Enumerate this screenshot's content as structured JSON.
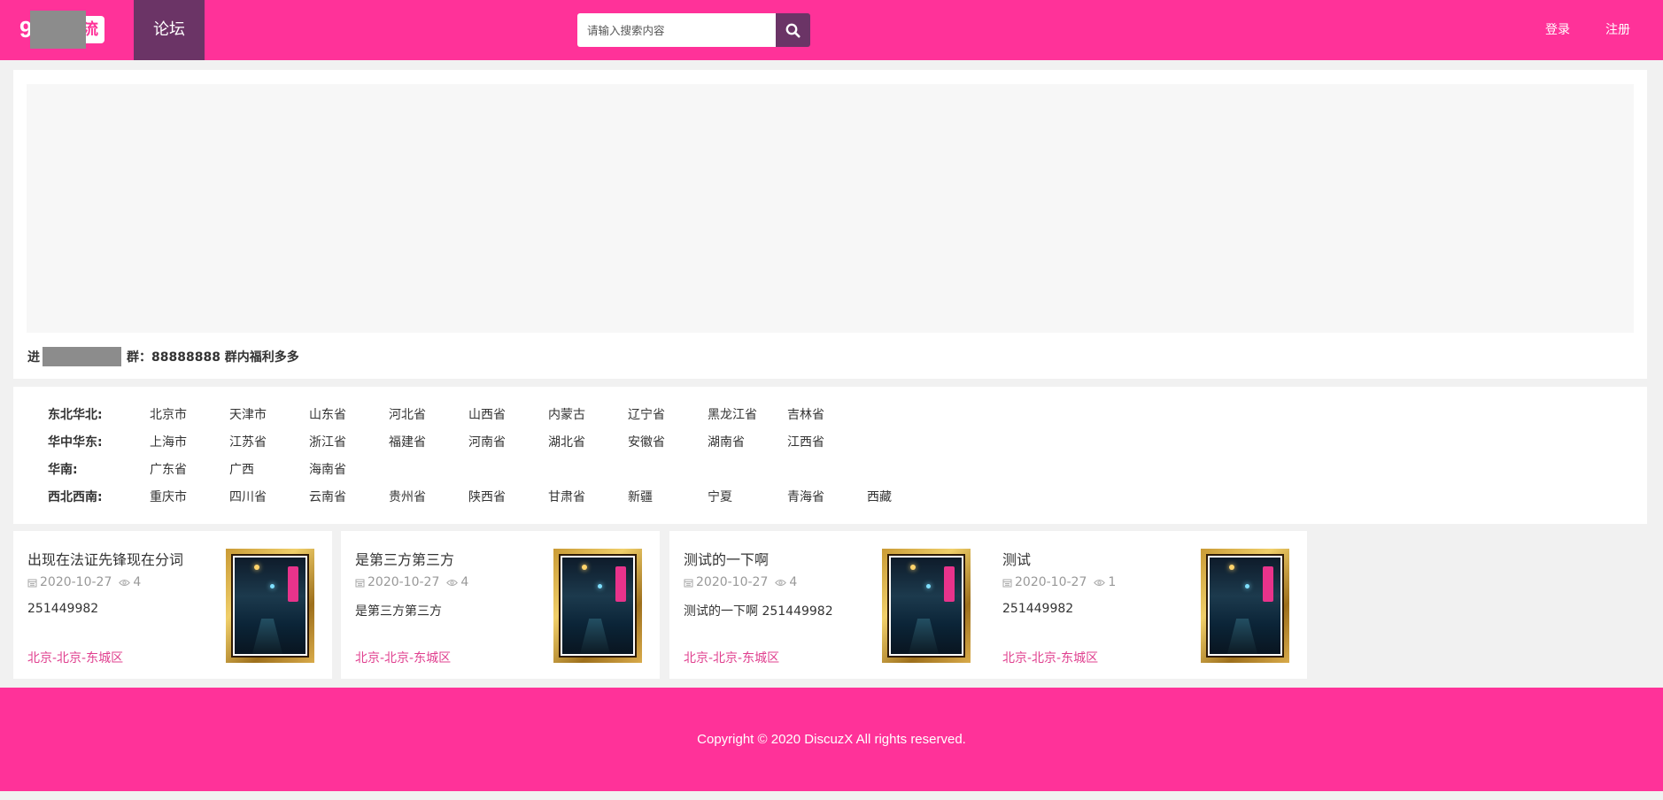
{
  "colors": {
    "brand": "#ff3299",
    "nav_active": "#6b3466",
    "location": "#e0408f"
  },
  "header": {
    "logo": {
      "mark": "9",
      "box_text": "流"
    },
    "nav": [
      {
        "label": "论坛",
        "active": true
      }
    ],
    "search": {
      "placeholder": "请输入搜索内容",
      "button_icon": "search-icon"
    },
    "login_label": "登录",
    "register_label": "注册"
  },
  "notice": {
    "prefix": "进",
    "text": "群：88888888 群内福利多多"
  },
  "regions": [
    {
      "label": "东北华北:",
      "cities": [
        "北京市",
        "天津市",
        "山东省",
        "河北省",
        "山西省",
        "内蒙古",
        "辽宁省",
        "黑龙江省",
        "吉林省"
      ]
    },
    {
      "label": "华中华东:",
      "cities": [
        "上海市",
        "江苏省",
        "浙江省",
        "福建省",
        "河南省",
        "湖北省",
        "安徽省",
        "湖南省",
        "江西省"
      ]
    },
    {
      "label": "华南:",
      "cities": [
        "广东省",
        "广西",
        "海南省"
      ]
    },
    {
      "label": "西北西南:",
      "cities": [
        "重庆市",
        "四川省",
        "云南省",
        "贵州省",
        "陕西省",
        "甘肃省",
        "新疆",
        "宁夏",
        "青海省",
        "西藏"
      ]
    }
  ],
  "posts": [
    {
      "title": "出现在法证先锋现在分词",
      "date": "2020-10-27",
      "views": "4",
      "excerpt": "251449982",
      "location": "北京-北京-东城区"
    },
    {
      "title": "是第三方第三方",
      "date": "2020-10-27",
      "views": "4",
      "excerpt": "是第三方第三方",
      "location": "北京-北京-东城区"
    },
    {
      "title": "测试的一下啊",
      "date": "2020-10-27",
      "views": "4",
      "excerpt": "测试的一下啊 251449982",
      "location": "北京-北京-东城区"
    },
    {
      "title": "测试",
      "date": "2020-10-27",
      "views": "1",
      "excerpt": "251449982",
      "location": "北京-北京-东城区"
    }
  ],
  "footer": {
    "copyright": "Copyright © 2020 DiscuzX All rights reserved."
  }
}
